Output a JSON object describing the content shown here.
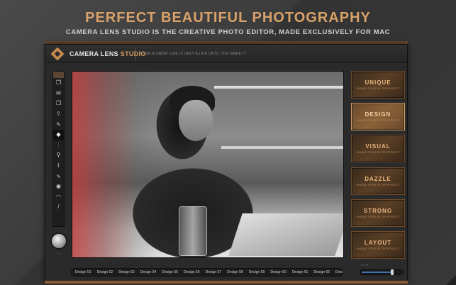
{
  "hero": {
    "headline": "PERFECT BEAUTIFUL PHOTOGRAPHY",
    "subline": "CAMERA LENS STUDIO IS THE CREATIVE PHOTO EDITOR, MADE EXCLUSIVELY FOR MAC"
  },
  "app": {
    "name_primary": "CAMERA LENS",
    "name_accent": "STUDIO",
    "tagline": "EVEN A GREAT LIFE IS ONLY A LIFE UNTIL YOU MAKE IT",
    "accent_color": "#d39a5c"
  },
  "toolbar": {
    "tools": [
      {
        "icon": "layers-icon",
        "glyph": "❐"
      },
      {
        "icon": "inbox-icon",
        "glyph": "✉"
      },
      {
        "icon": "copy-icon",
        "glyph": "❒"
      },
      {
        "icon": "export-icon",
        "glyph": "⇪"
      },
      {
        "icon": "edit-icon",
        "glyph": "✎"
      },
      {
        "icon": "diamond-icon",
        "glyph": "◆",
        "active": true
      },
      {
        "icon": "adjust-sliders-icon",
        "glyph": "⫶"
      },
      {
        "icon": "pin-icon",
        "glyph": "⚲"
      },
      {
        "icon": "brush-icon",
        "glyph": "⌇"
      },
      {
        "icon": "waveform-icon",
        "glyph": "∿"
      },
      {
        "icon": "eye-icon",
        "glyph": "◉"
      },
      {
        "icon": "gauge-icon",
        "glyph": "◠"
      },
      {
        "icon": "pencil-icon",
        "glyph": "/"
      }
    ]
  },
  "presets": [
    {
      "title": "UNIQUE",
      "sub": "UNIQUE STYLE FILTER EFFECTS",
      "selected": false
    },
    {
      "title": "DESIGN",
      "sub": "UNIQUE STYLE FILTER EFFECTS",
      "selected": true
    },
    {
      "title": "VISUAL",
      "sub": "UNIQUE STYLE FILTER EFFECTS",
      "selected": false
    },
    {
      "title": "DAZZLE",
      "sub": "UNIQUE STYLE FILTER EFFECTS",
      "selected": false
    },
    {
      "title": "STRONG",
      "sub": "UNIQUE STYLE FILTER EFFECTS",
      "selected": false
    },
    {
      "title": "LAYOUT",
      "sub": "UNIQUE STYLE FILTER EFFECTS",
      "selected": false
    }
  ],
  "designs": [
    "Design 51",
    "Design 52",
    "Design 53",
    "Design 54",
    "Design 55",
    "Design 56",
    "Design 57",
    "Design 58",
    "Design 59",
    "Design 60",
    "Design 61",
    "Design 62",
    "Desig"
  ],
  "slider": {
    "value": 0.75
  }
}
